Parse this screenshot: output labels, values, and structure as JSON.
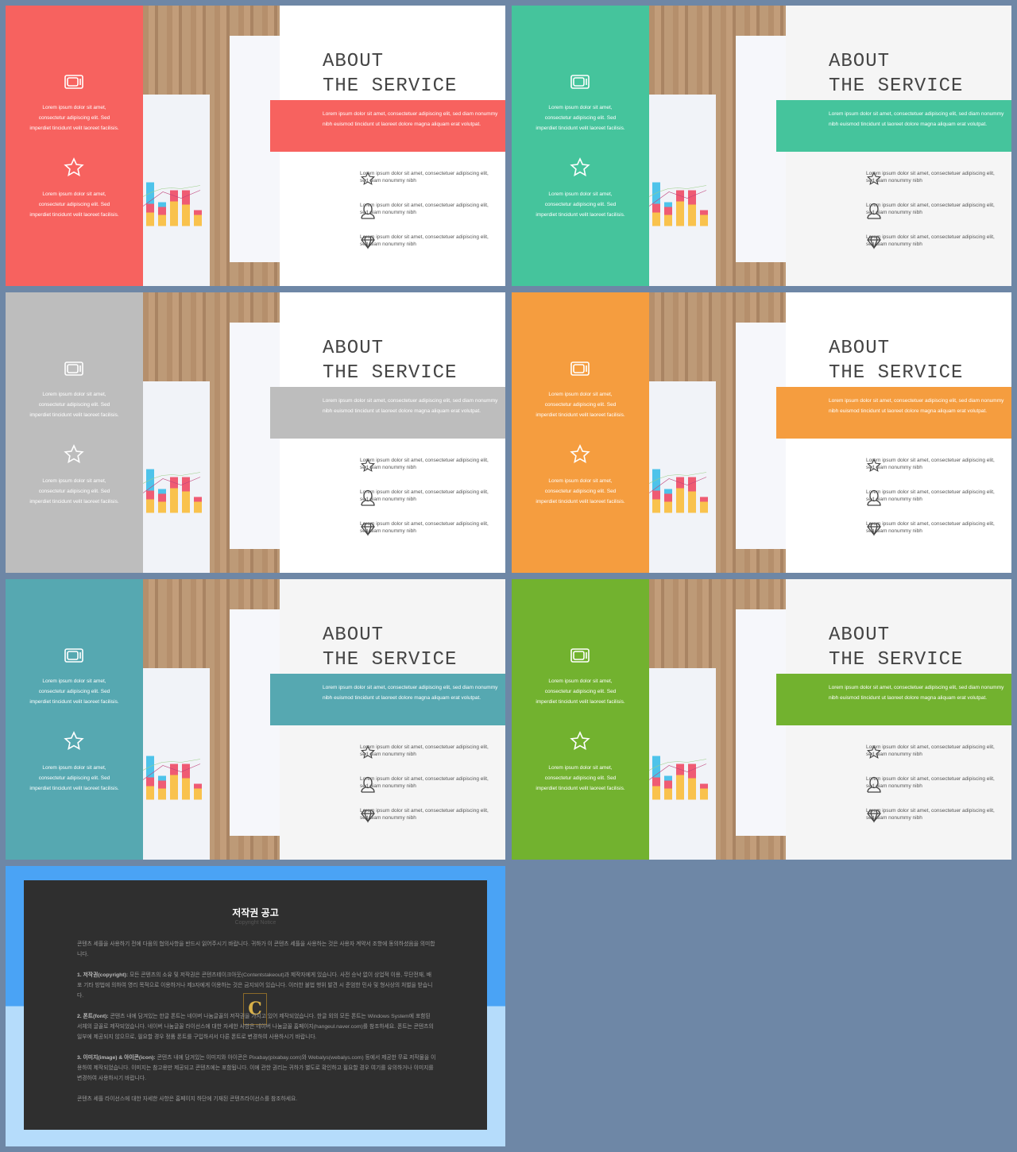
{
  "slide": {
    "title_line1": "ABOUT",
    "title_line2": "THE SERVICE",
    "panel_text": "Lorem ipsum dolor sit amet, consectetur adipiscing elit. Sed imperdiet tincidunt velit laoreet facilisis.",
    "band_text": "Lorem ipsum dolor sit amet, consectetuer adipiscing elit, sed diam nonummy nibh euismod tincidunt ut laoreet dolore magna aliquam erat volutpat.",
    "features": [
      {
        "icon": "star-icon",
        "text": "Lorem ipsum dolor sit amet, consectetuer adipiscing elit, sed diam nonummy nibh"
      },
      {
        "icon": "user-icon",
        "text": "Lorem ipsum dolor sit amet, consectetuer adipiscing elit, sed diam nonummy nibh"
      },
      {
        "icon": "diamond-icon",
        "text": "Lorem ipsum dolor sit amet, consectetuer adipiscing elit, sed diam nonummy nibh"
      }
    ],
    "panel_icons": [
      "tv-icon",
      "star-icon"
    ]
  },
  "variants": [
    {
      "accent": "#f7625f",
      "bg": "#ffffff"
    },
    {
      "accent": "#45c49c",
      "bg": "#f5f5f5"
    },
    {
      "accent": "#bdbdbd",
      "bg": "#ffffff"
    },
    {
      "accent": "#f59d3f",
      "bg": "#ffffff"
    },
    {
      "accent": "#56a8b1",
      "bg": "#f5f5f5"
    },
    {
      "accent": "#72b22f",
      "bg": "#f5f5f5"
    }
  ],
  "notice": {
    "title": "저작권 공고",
    "subtitle": "Copyright Notice",
    "intro": "콘텐츠 세플을 사용하기 전에 다음의 협의사항을 반드시 읽어주시기 바랍니다. 귀하가 이 콘텐츠 세플을 사용하는 것은 사용자 계약서 조항에 동의하셨음을 의미합니다.",
    "p1_head": "1. 저작권(copyright):",
    "p1": "모든 콘텐츠의 소유 및 저작권은 콘텐츠테이크아웃(Contentstakeout)과 제작자에게 있습니다. 사전 승낙 없이 상업적 이용, 무단전재, 배포 기타 방법에 의하여 영리 목적으로 이용하거나 제3자에게 이용하는 것은 금지되어 있습니다. 이러한 불법 행위 발견 시 준엄한 민사 및 형사상의 처벌을 받습니다.",
    "p2_head": "2. 폰트(font):",
    "p2": "콘텐츠 내에 담겨있는 한글 폰트는 네이버 나눔글꼴의 저작권을 가지고 있어 제작되었습니다. 한글 외의 모든 폰트는 Windows System에 포함된 서체의 글꼴로 제작되었습니다. 네이버 나눔글꼴 라이선스에 대한 자세한 사항은 네이버 나눔글꼴 홈페이지(hangeul.naver.com)를 참조하세요. 폰트는 콘텐츠의 일부에 제공되지 않으므로, 필요할 경우 정품 폰트를 구입하셔서 다른 폰트로 변경하여 사용하시기 바랍니다.",
    "p3_head": "3. 이미지(image) & 아이콘(icon):",
    "p3": "콘텐츠 내에 담겨있는 이미지와 아이콘은 Pixabay(pixabay.com)와 Webalys(webalys.com) 등에서 제공한 무료 저작물을 이용하여 제작되었습니다. 이미지는 참고용만 제공되고 콘텐츠에는 포함됩니다. 이에 관한 권리는 귀하가 별도로 확인하고 필요할 경우 여기를 유의하거나 이미지를 변경하여 사용하시기 바랍니다.",
    "outro": "콘텐츠 세플 라이선스에 대한 자세한 사항은 홈페이지 하단에 기재된 콘텐츠라이선스를 참조하세요.",
    "seal": "C",
    "colors": {
      "top": "#4aa3f5",
      "bottom": "#b5dcfb",
      "box": "#2f2f2f"
    }
  }
}
